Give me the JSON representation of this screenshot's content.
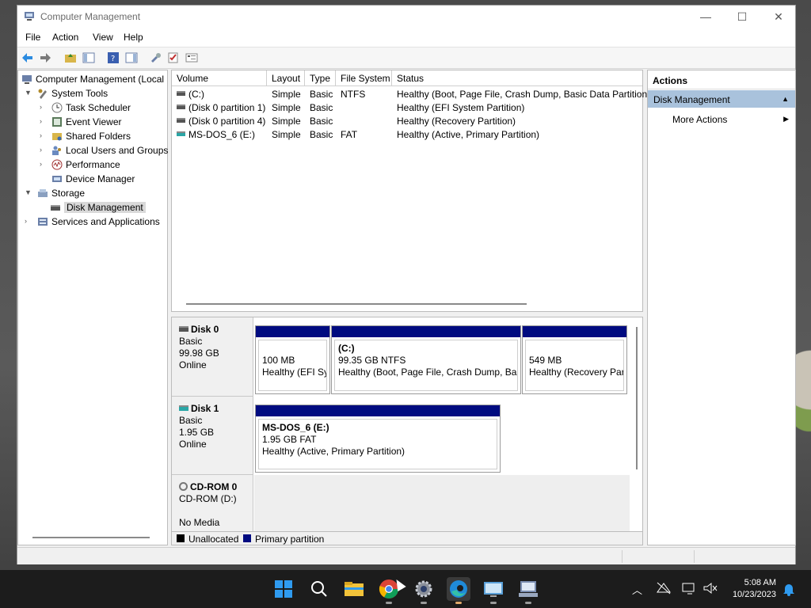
{
  "window": {
    "title": "Computer Management",
    "controls": {
      "minimize": "—",
      "maximize": "☐",
      "close": "✕"
    }
  },
  "menu": [
    "File",
    "Action",
    "View",
    "Help"
  ],
  "tree": {
    "root": "Computer Management (Local",
    "system_tools": "System Tools",
    "items": [
      "Task Scheduler",
      "Event Viewer",
      "Shared Folders",
      "Local Users and Groups",
      "Performance",
      "Device Manager"
    ],
    "storage": "Storage",
    "disk_management": "Disk Management",
    "services": "Services and Applications"
  },
  "volume_list": {
    "columns": [
      "Volume",
      "Layout",
      "Type",
      "File System",
      "Status"
    ],
    "rows": [
      {
        "volume": "(C:)",
        "layout": "Simple",
        "type": "Basic",
        "fs": "NTFS",
        "status": "Healthy (Boot, Page File, Crash Dump, Basic Data Partition)"
      },
      {
        "volume": "(Disk 0 partition 1)",
        "layout": "Simple",
        "type": "Basic",
        "fs": "",
        "status": "Healthy (EFI System Partition)"
      },
      {
        "volume": "(Disk 0 partition 4)",
        "layout": "Simple",
        "type": "Basic",
        "fs": "",
        "status": "Healthy (Recovery Partition)"
      },
      {
        "volume": "MS-DOS_6 (E:)",
        "layout": "Simple",
        "type": "Basic",
        "fs": "FAT",
        "status": "Healthy (Active, Primary Partition)"
      }
    ]
  },
  "disks": [
    {
      "name": "Disk 0",
      "type": "Basic",
      "size": "99.98 GB",
      "state": "Online",
      "partitions": [
        {
          "title": "",
          "size": "100 MB",
          "status": "Healthy (EFI Sys"
        },
        {
          "title": "(C:)",
          "size": "99.35 GB NTFS",
          "status": "Healthy (Boot, Page File, Crash Dump, Basi"
        },
        {
          "title": "",
          "size": "549 MB",
          "status": "Healthy (Recovery Part"
        }
      ]
    },
    {
      "name": "Disk 1",
      "type": "Basic",
      "size": "1.95 GB",
      "state": "Online",
      "partitions": [
        {
          "title": "MS-DOS_6  (E:)",
          "size": "1.95 GB FAT",
          "status": "Healthy (Active, Primary Partition)"
        }
      ]
    },
    {
      "name": "CD-ROM 0",
      "type": "CD-ROM (D:)",
      "media": "No Media"
    }
  ],
  "legend": {
    "unallocated": "Unallocated",
    "primary": "Primary partition",
    "unallocated_color": "#000000",
    "primary_color": "#000b80"
  },
  "actions": {
    "header": "Actions",
    "section": "Disk Management",
    "more": "More Actions"
  },
  "taskbar": {
    "apps": [
      "start-icon",
      "search-icon",
      "file-explorer-icon",
      "chrome-icon",
      "settings-icon",
      "edge-icon",
      "remote-desktop-icon",
      "computer-management-icon"
    ],
    "time": "5:08 AM",
    "date": "10/23/2023"
  }
}
